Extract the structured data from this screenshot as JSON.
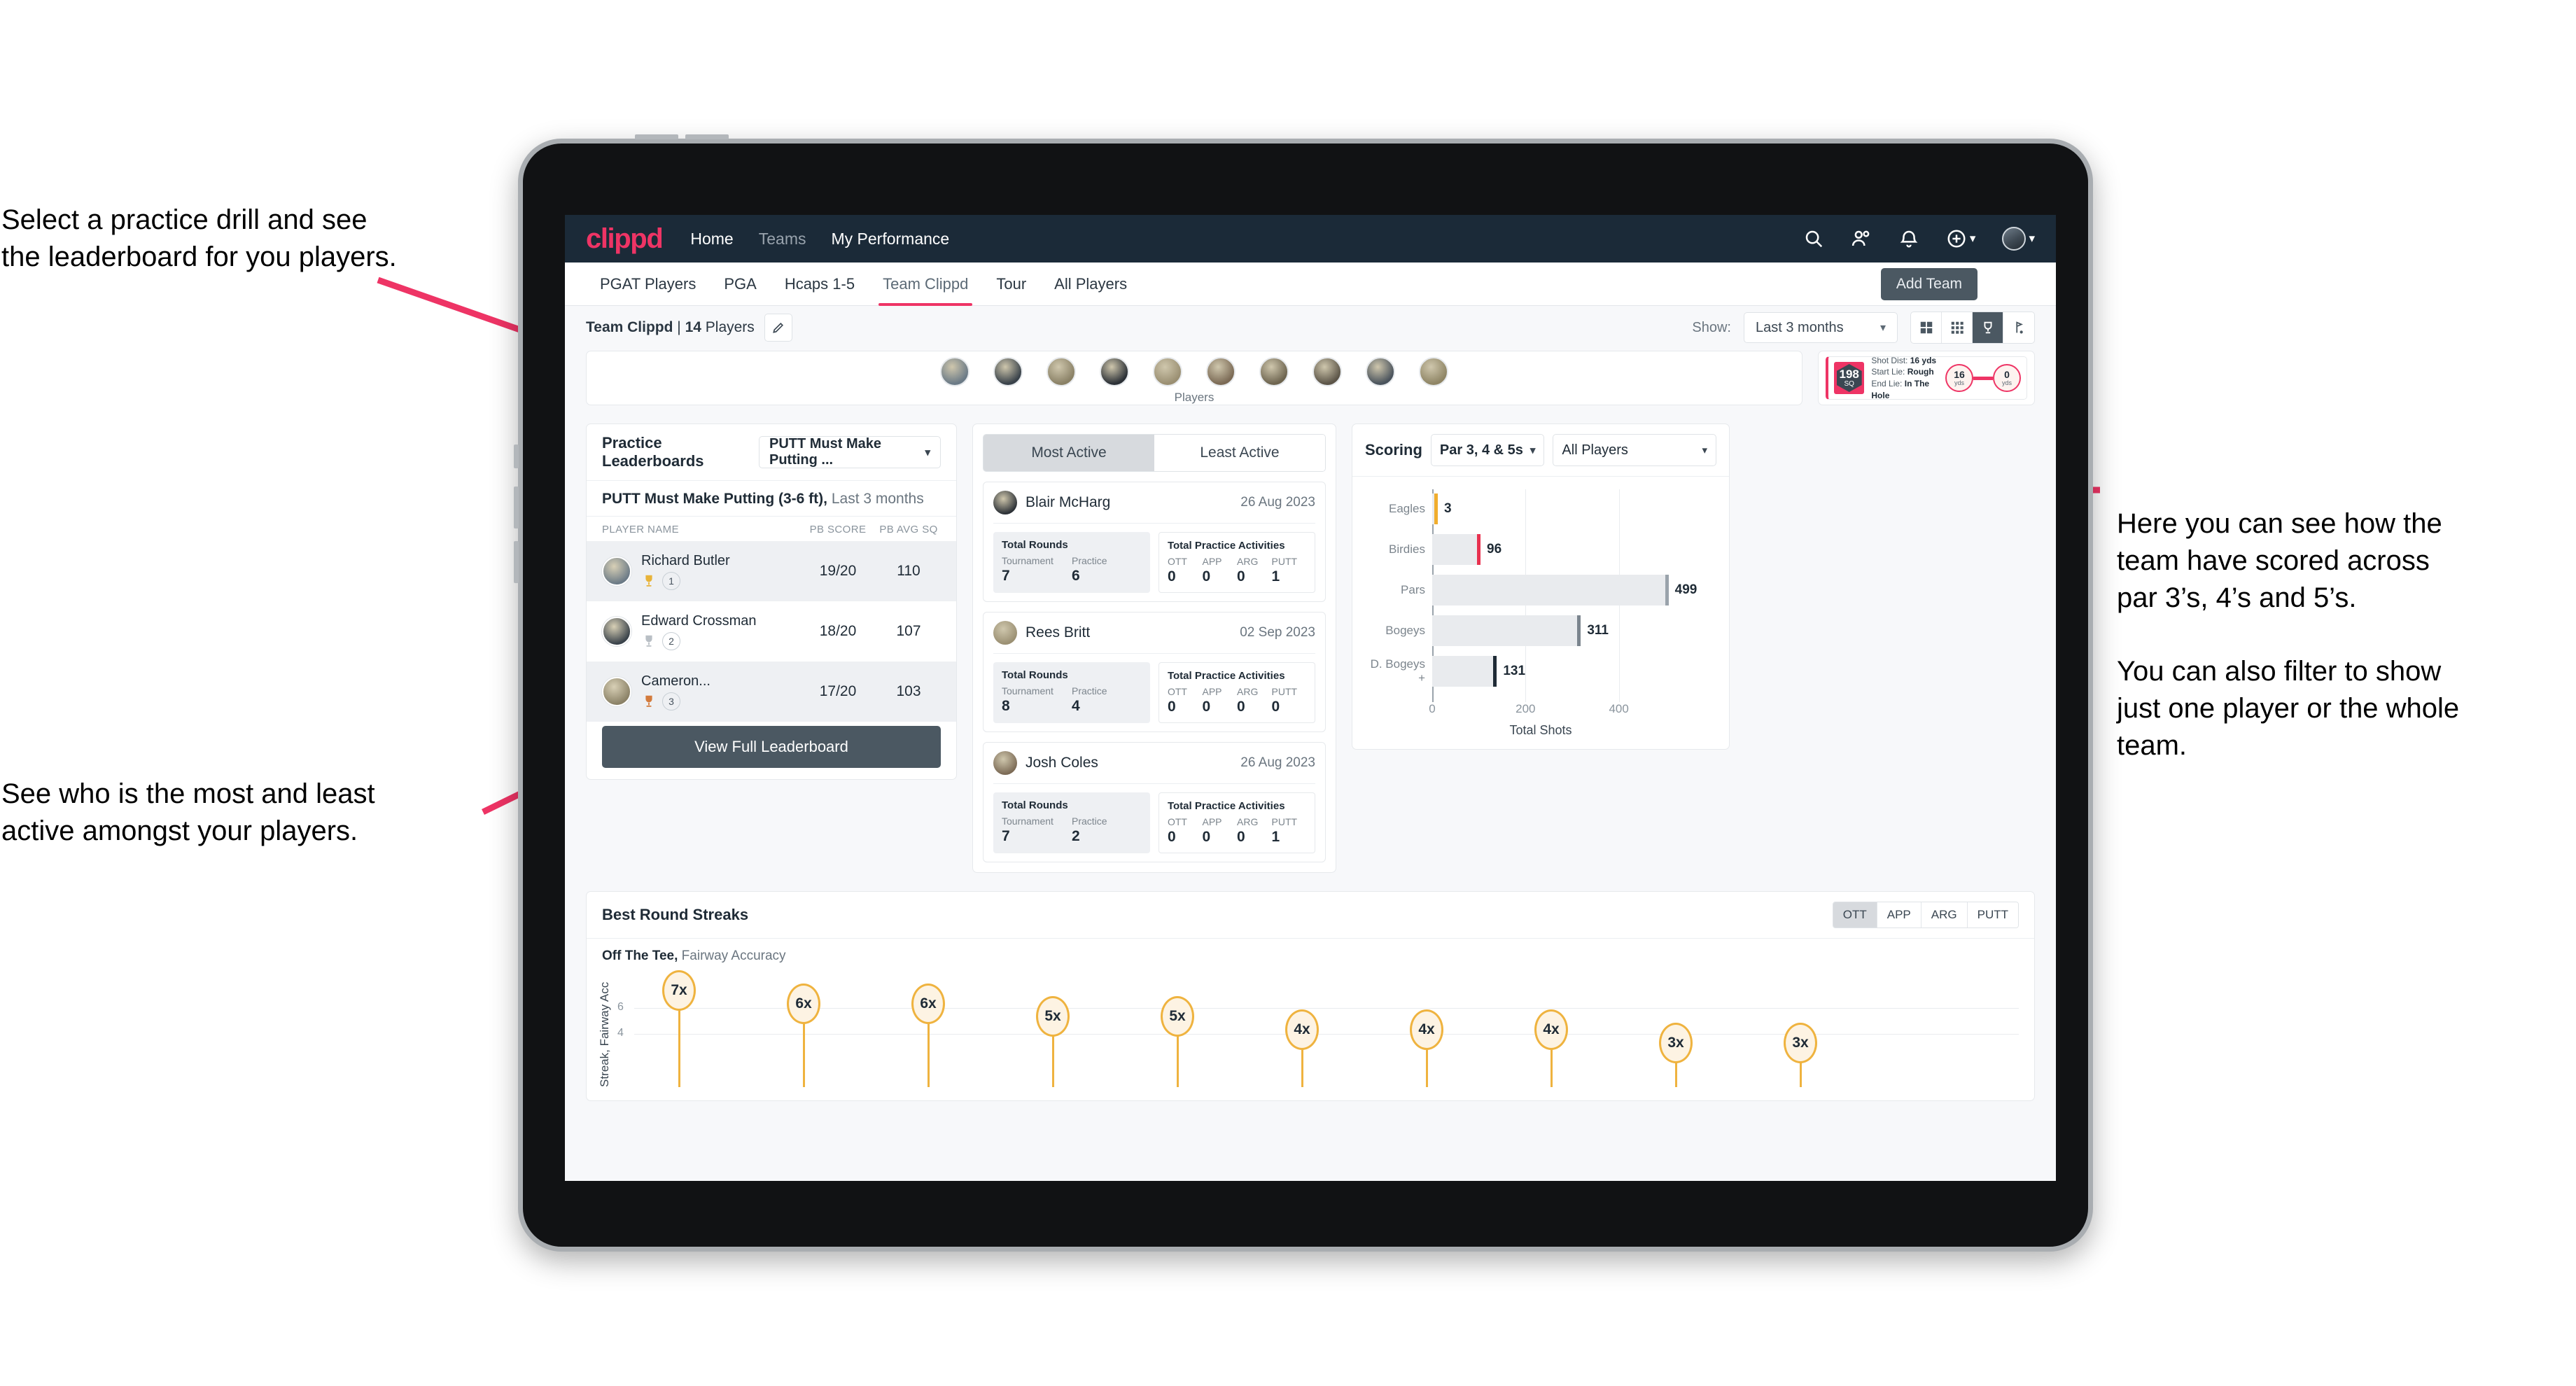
{
  "annotations": {
    "top_left": "Select a practice drill and see\nthe leaderboard for you players.",
    "bottom_left": "See who is the most and least\nactive amongst your players.",
    "right": "Here you can see how the\nteam have scored across\npar 3’s, 4’s and 5’s.\n\nYou can also filter to show\njust one player or the whole\nteam."
  },
  "topnav": {
    "logo": "clippd",
    "links": [
      {
        "label": "Home",
        "dim": false
      },
      {
        "label": "Teams",
        "dim": true
      },
      {
        "label": "My Performance",
        "dim": false
      }
    ],
    "icons": [
      "search-icon",
      "people-icon",
      "bell-icon",
      "plus-circle-icon",
      "avatar"
    ]
  },
  "tabs": [
    {
      "label": "PGAT Players",
      "active": false
    },
    {
      "label": "PGA",
      "active": false
    },
    {
      "label": "Hcaps 1-5",
      "active": false
    },
    {
      "label": "Team Clippd",
      "active": true
    },
    {
      "label": "Tour",
      "active": false
    },
    {
      "label": "All Players",
      "active": false
    }
  ],
  "add_team_button": "Add Team",
  "filterbar": {
    "team_name": "Team Clippd",
    "separator": " | ",
    "player_count": "14",
    "players_word": " Players",
    "show_label": "Show:",
    "period_value": "Last 3 months",
    "view_modes": [
      "grid-large-icon",
      "grid-small-icon",
      "trophy-icon",
      "golf-flag-icon"
    ],
    "active_view_index": 2
  },
  "players_card": {
    "caption": "Players",
    "avatar_count": 10
  },
  "shot_card": {
    "sq_value": "198",
    "sq_unit": "SQ",
    "lines": [
      {
        "label": "Shot Dist: ",
        "value": "16 yds"
      },
      {
        "label": "Start Lie: ",
        "value": "Rough"
      },
      {
        "label": "End Lie: ",
        "value": "In The Hole"
      }
    ],
    "start_distance": "16",
    "start_unit": "yds",
    "end_distance": "0",
    "end_unit": "yds"
  },
  "practice_leaderboard": {
    "title": "Practice Leaderboards",
    "drill_select": "PUTT Must Make Putting ...",
    "subtitle_bold": "PUTT Must Make Putting (3-6 ft),",
    "subtitle_rest": " Last 3 months",
    "columns": [
      "PLAYER NAME",
      "PB SCORE",
      "PB AVG SQ"
    ],
    "rows": [
      {
        "name": "Richard Butler",
        "rank": "1",
        "medal": "gold",
        "pb_score": "19/20",
        "pb_avg_sq": "110",
        "highlight": true
      },
      {
        "name": "Edward Crossman",
        "rank": "2",
        "medal": "silver",
        "pb_score": "18/20",
        "pb_avg_sq": "107",
        "highlight": false
      },
      {
        "name": "Cameron...",
        "rank": "3",
        "medal": "bronze",
        "pb_score": "17/20",
        "pb_avg_sq": "103",
        "highlight": true
      }
    ],
    "view_full_button": "View Full Leaderboard"
  },
  "activity": {
    "tabs": [
      {
        "label": "Most Active",
        "active": true
      },
      {
        "label": "Least Active",
        "active": false
      }
    ],
    "rounds_title": "Total Rounds",
    "rounds_keys": [
      "Tournament",
      "Practice"
    ],
    "activities_title": "Total Practice Activities",
    "activities_keys": [
      "OTT",
      "APP",
      "ARG",
      "PUTT"
    ],
    "items": [
      {
        "name": "Blair McHarg",
        "date": "26 Aug 2023",
        "rounds": [
          "7",
          "6"
        ],
        "activities": [
          "0",
          "0",
          "0",
          "1"
        ]
      },
      {
        "name": "Rees Britt",
        "date": "02 Sep 2023",
        "rounds": [
          "8",
          "4"
        ],
        "activities": [
          "0",
          "0",
          "0",
          "0"
        ]
      },
      {
        "name": "Josh Coles",
        "date": "26 Aug 2023",
        "rounds": [
          "7",
          "2"
        ],
        "activities": [
          "0",
          "0",
          "0",
          "1"
        ]
      }
    ]
  },
  "scoring": {
    "title": "Scoring",
    "par_select": "Par 3, 4 & 5s",
    "player_select": "All Players"
  },
  "streaks": {
    "title": "Best Round Streaks",
    "segments": [
      {
        "label": "OTT",
        "active": true
      },
      {
        "label": "APP",
        "active": false
      },
      {
        "label": "ARG",
        "active": false
      },
      {
        "label": "PUTT",
        "active": false
      }
    ],
    "sub_bold": "Off The Tee,",
    "sub_rest": " Fairway Accuracy"
  },
  "chart_data": [
    {
      "type": "bar",
      "orientation": "horizontal",
      "title": "Scoring",
      "categories": [
        "Eagles",
        "Birdies",
        "Pars",
        "Bogeys",
        "D. Bogeys +"
      ],
      "values": [
        3,
        96,
        499,
        311,
        131
      ],
      "cap_colors": [
        "#f0ad2e",
        "#e8314f",
        "#9aa3ab",
        "#7b858e",
        "#1f2b36"
      ],
      "xlabel": "Total Shots",
      "ylabel": "",
      "xticks": [
        0,
        200,
        400
      ],
      "xlim": [
        0,
        540
      ],
      "grid": true,
      "legend": "none"
    },
    {
      "type": "bar",
      "orientation": "vertical-lollipop",
      "title": "Best Round Streaks",
      "subtitle": "Off The Tee, Fairway Accuracy",
      "ylabel": "Streak, Fairway Accuracy",
      "categories": [
        "",
        "",
        "",
        "",
        "",
        "",
        "",
        "",
        "",
        "",
        ""
      ],
      "values": [
        7,
        6,
        6,
        5,
        5,
        4,
        4,
        4,
        3,
        3
      ],
      "labels": [
        "7x",
        "6x",
        "6x",
        "5x",
        "5x",
        "4x",
        "4x",
        "4x",
        "3x",
        "3x"
      ],
      "yticks": [
        4,
        6
      ],
      "ylim": [
        0,
        8
      ],
      "grid": true,
      "legend": "none"
    }
  ]
}
